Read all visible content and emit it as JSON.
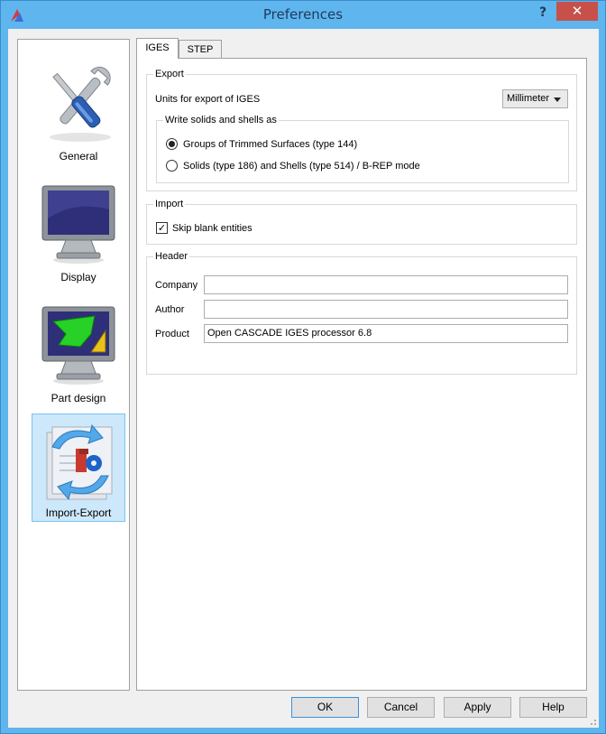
{
  "window": {
    "title": "Preferences",
    "help": "?",
    "close": "✕"
  },
  "sidebar": {
    "items": [
      {
        "label": "General",
        "icon": "tools-icon"
      },
      {
        "label": "Display",
        "icon": "monitor-icon"
      },
      {
        "label": "Part design",
        "icon": "part-design-icon"
      },
      {
        "label": "Import-Export",
        "icon": "import-export-icon",
        "selected": true
      }
    ]
  },
  "tabs": [
    "IGES",
    "STEP"
  ],
  "export": {
    "title": "Export",
    "units_label": "Units for export of IGES",
    "units_value": "Millimeter",
    "write_group_title": "Write solids and shells as",
    "options": [
      "Groups of Trimmed Surfaces (type 144)",
      "Solids (type 186) and Shells (type 514) / B-REP mode"
    ]
  },
  "import": {
    "title": "Import",
    "skip_label": "Skip blank entities",
    "check_mark": "✓"
  },
  "header": {
    "title": "Header",
    "company_label": "Company",
    "company_value": "",
    "author_label": "Author",
    "author_value": "",
    "product_label": "Product",
    "product_value": "Open CASCADE IGES processor 6.8"
  },
  "buttons": {
    "ok": "OK",
    "cancel": "Cancel",
    "apply": "Apply",
    "help": "Help"
  },
  "colors": {
    "titlebar": "#5fb5ee",
    "close": "#c7504b",
    "selection": "#cde8fb"
  }
}
